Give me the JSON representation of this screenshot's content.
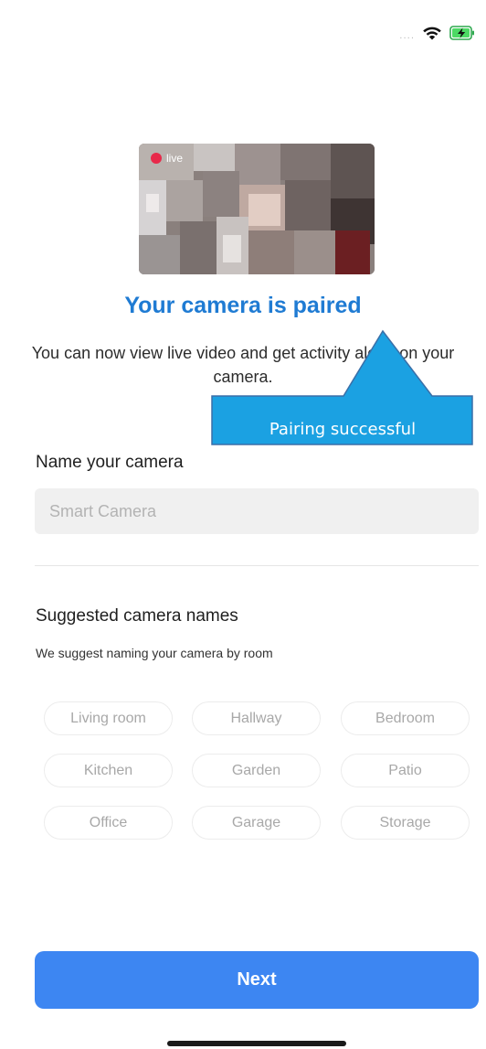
{
  "status_bar": {
    "signal": "....",
    "wifi_icon": "wifi-icon",
    "battery_icon": "battery-charging-icon"
  },
  "preview": {
    "live_label": "live",
    "live_color": "#e8294a"
  },
  "header": {
    "title": "Your camera is paired",
    "description": "You can now view live video and get activity alerts on your camera."
  },
  "callout": {
    "text": "Pairing successful",
    "color": "#1ba1e2"
  },
  "name_section": {
    "label": "Name your camera",
    "placeholder": "Smart Camera",
    "value": ""
  },
  "suggestions": {
    "title": "Suggested camera names",
    "subtitle": "We suggest naming your camera by room",
    "chips": [
      "Living room",
      "Hallway",
      "Bedroom",
      "Kitchen",
      "Garden",
      "Patio",
      "Office",
      "Garage",
      "Storage"
    ]
  },
  "actions": {
    "next_label": "Next"
  },
  "colors": {
    "accent": "#3d86f2",
    "title": "#1f7bd3"
  }
}
